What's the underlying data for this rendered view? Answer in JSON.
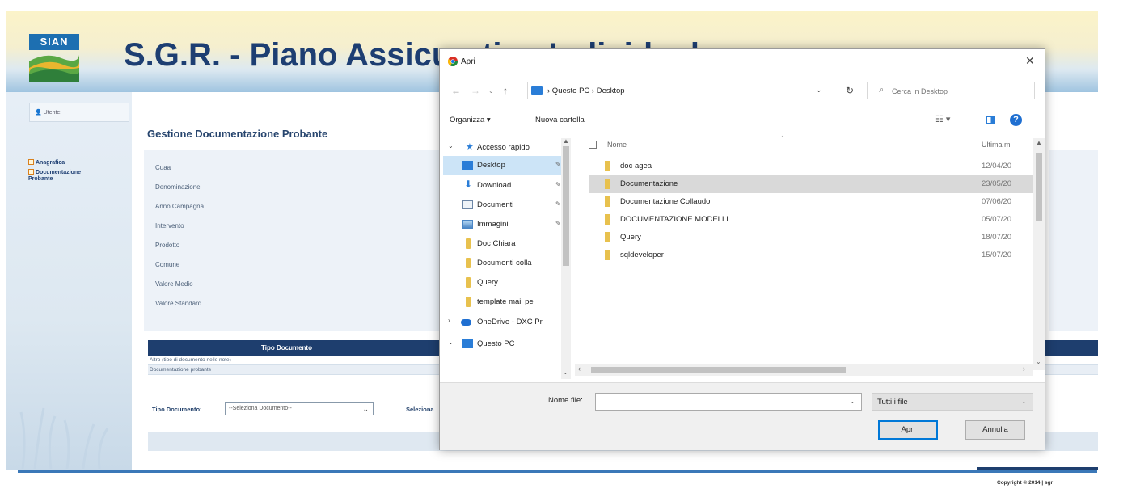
{
  "site": {
    "logo_text": "SIAN",
    "title": "S.G.R. - Piano Assicurativo Individuale",
    "user_label": "Utente:",
    "sidebar": [
      {
        "label": "Anagrafica"
      },
      {
        "label": "Documentazione Probante"
      }
    ],
    "section_title": "Gestione Documentazione Probante",
    "form_labels": [
      "Cuaa",
      "Denominazione",
      "Anno Campagna",
      "Intervento",
      "Prodotto",
      "Comune",
      "Valore Medio",
      "Valore Standard"
    ],
    "table": {
      "header": "Tipo Documento",
      "rows": [
        "Altro (tipo di documento nelle note)",
        "Documentazione probante"
      ]
    },
    "filter": {
      "type_label": "Tipo Documento:",
      "type_value": "--Seleziona Documento--",
      "select_label": "Seleziona"
    },
    "copyright": "Copyright © 2014 | sgr"
  },
  "dialog": {
    "title": "Apri",
    "breadcrumb": "› Questo PC › Desktop",
    "search_placeholder": "Cerca in Desktop",
    "toolbar": {
      "organize": "Organizza ▾",
      "new_folder": "Nuova cartella"
    },
    "nav": {
      "quick_access": "Accesso rapido",
      "items": [
        {
          "label": "Desktop",
          "icon": "desktop-icon",
          "pinned": true,
          "selected": true
        },
        {
          "label": "Download",
          "icon": "download-icon",
          "pinned": true
        },
        {
          "label": "Documenti",
          "icon": "documents-icon",
          "pinned": true
        },
        {
          "label": "Immagini",
          "icon": "pictures-icon",
          "pinned": true
        },
        {
          "label": "Doc Chiara",
          "icon": "folder-icon"
        },
        {
          "label": "Documenti colla",
          "icon": "folder-icon"
        },
        {
          "label": "Query",
          "icon": "folder-icon"
        },
        {
          "label": "template mail pe",
          "icon": "folder-icon"
        }
      ],
      "onedrive": "OneDrive - DXC Pr",
      "this_pc": "Questo PC"
    },
    "columns": {
      "name": "Nome",
      "date": "Ultima m"
    },
    "files": [
      {
        "name": "doc agea",
        "date": "12/04/20"
      },
      {
        "name": "Documentazione",
        "date": "23/05/20",
        "selected": true
      },
      {
        "name": "Documentazione Collaudo",
        "date": "07/06/20"
      },
      {
        "name": "DOCUMENTAZIONE MODELLI",
        "date": "05/07/20"
      },
      {
        "name": "Query",
        "date": "18/07/20"
      },
      {
        "name": "sqldeveloper",
        "date": "15/07/20"
      }
    ],
    "filename_label": "Nome file:",
    "filename_value": "",
    "file_type": "Tutti i file",
    "open_button": "Apri",
    "cancel_button": "Annulla"
  }
}
